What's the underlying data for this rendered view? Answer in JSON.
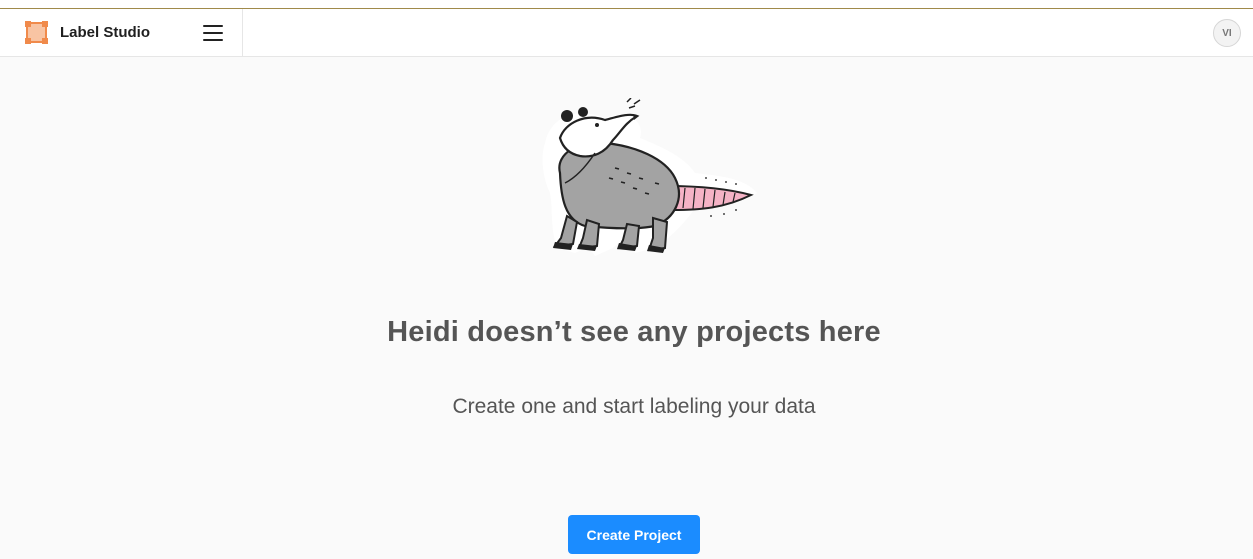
{
  "app": {
    "name": "Label Studio",
    "logo_icon": "label-studio-logo-icon",
    "menu_icon": "hamburger-menu-icon"
  },
  "user": {
    "initials": "VI"
  },
  "empty_state": {
    "illustration": "opossum-illustration",
    "title": "Heidi doesn’t see any projects here",
    "subtitle": "Create one and start labeling your data",
    "cta_label": "Create Project"
  },
  "colors": {
    "accent": "#1b8cff",
    "logo": "#f08a4b",
    "background": "#fafafa"
  }
}
